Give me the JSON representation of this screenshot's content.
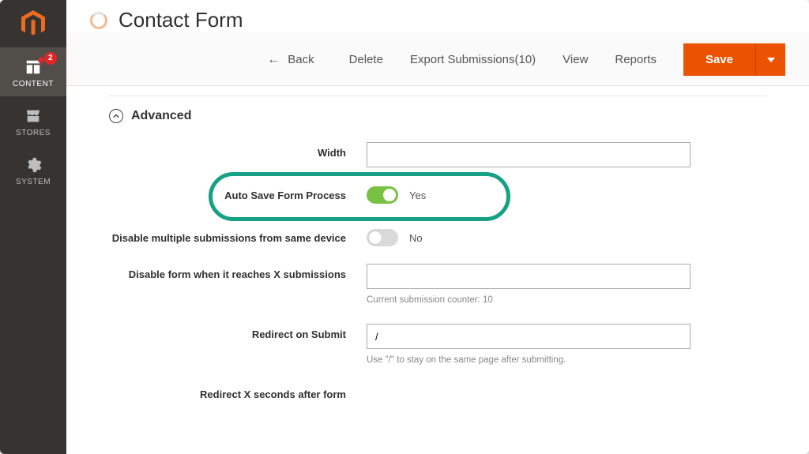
{
  "sidebar": {
    "items": [
      {
        "name": "content",
        "label": "CONTENT",
        "badge": "2",
        "active": true
      },
      {
        "name": "stores",
        "label": "STORES"
      },
      {
        "name": "system",
        "label": "SYSTEM"
      }
    ]
  },
  "page": {
    "title": "Contact Form"
  },
  "toolbar": {
    "back": "Back",
    "delete": "Delete",
    "export": "Export Submissions(10)",
    "view": "View",
    "reports": "Reports",
    "save": "Save"
  },
  "section": {
    "title": "Advanced"
  },
  "fields": {
    "width": {
      "label": "Width",
      "value": ""
    },
    "autosave": {
      "label": "Auto Save Form Process",
      "value": "Yes",
      "on": true
    },
    "disable_multiple": {
      "label": "Disable multiple submissions from same device",
      "value": "No",
      "on": false
    },
    "disable_x": {
      "label": "Disable form when it reaches X submissions",
      "value": "",
      "help": "Current submission counter: 10"
    },
    "redirect": {
      "label": "Redirect on Submit",
      "value": "/",
      "help": "Use \"/\" to stay on the same page after submitting."
    },
    "redirect_delay": {
      "label": "Redirect X seconds after form"
    }
  }
}
